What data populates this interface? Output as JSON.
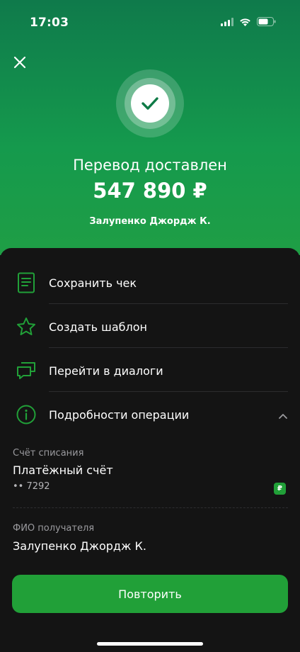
{
  "status_bar": {
    "time": "17:03"
  },
  "header": {
    "title": "Перевод доставлен",
    "amount": "547 890 ₽",
    "recipient": "Залупенко Джордж К."
  },
  "actions": [
    {
      "label": "Сохранить чек",
      "icon": "receipt-icon"
    },
    {
      "label": "Создать шаблон",
      "icon": "star-icon"
    },
    {
      "label": "Перейти в диалоги",
      "icon": "chat-icon"
    },
    {
      "label": "Подробности операции",
      "icon": "info-icon"
    }
  ],
  "details": {
    "account_label": "Счёт списания",
    "account_value": "Платёжный счёт",
    "account_number": "•• 7292",
    "currency_badge": "₽",
    "recipient_label": "ФИО получателя",
    "recipient_value": "Залупенко Джордж К."
  },
  "footer": {
    "repeat_label": "Повторить"
  },
  "colors": {
    "accent": "#21a038",
    "sheet_bg": "#141414",
    "header_top": "#0f7a4b"
  }
}
